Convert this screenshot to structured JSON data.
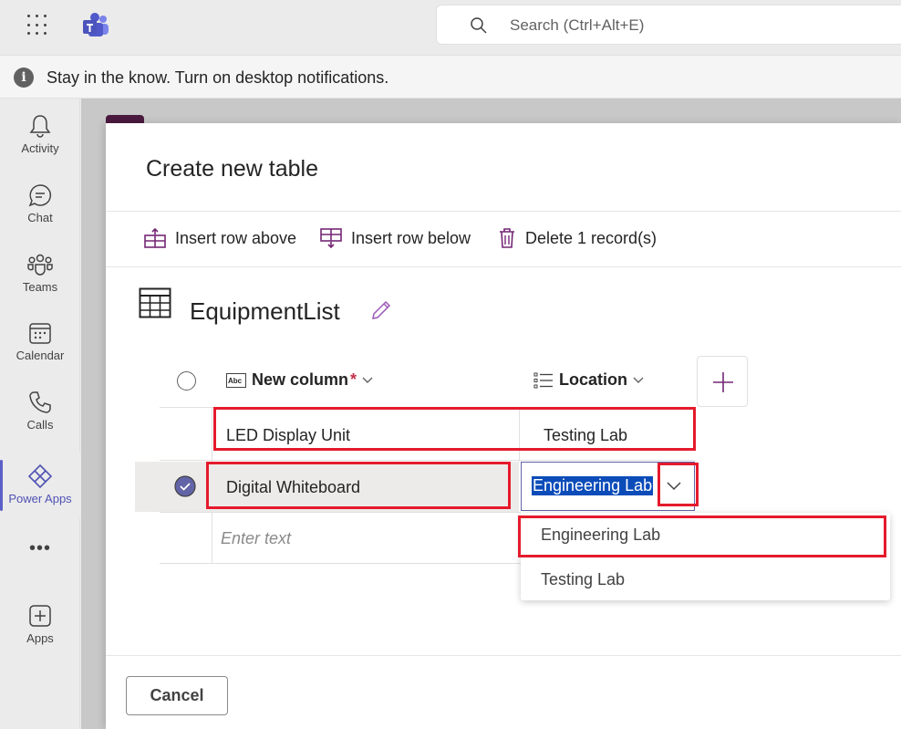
{
  "topbar": {
    "search_placeholder": "Search (Ctrl+Alt+E)"
  },
  "notification": {
    "text": "Stay in the know. Turn on desktop notifications."
  },
  "rail": {
    "items": [
      {
        "label": "Activity",
        "icon": "bell-icon"
      },
      {
        "label": "Chat",
        "icon": "chat-icon"
      },
      {
        "label": "Teams",
        "icon": "teams-icon"
      },
      {
        "label": "Calendar",
        "icon": "calendar-icon"
      },
      {
        "label": "Calls",
        "icon": "phone-icon"
      },
      {
        "label": "Power Apps",
        "icon": "power-apps-icon"
      },
      {
        "label": "Apps",
        "icon": "add-app-icon"
      }
    ],
    "more": "•••"
  },
  "modal": {
    "title": "Create new table",
    "toolbar": {
      "insert_above": "Insert row above",
      "insert_below": "Insert row below",
      "delete": "Delete 1 record(s)"
    },
    "table_name": "EquipmentList",
    "columns": [
      {
        "label": "New column",
        "required_mark": "*"
      },
      {
        "label": "Location"
      }
    ],
    "rows": [
      {
        "col1": "LED Display Unit",
        "col2": "Testing Lab"
      },
      {
        "col1": "Digital Whiteboard",
        "col2": "Engineering Lab"
      }
    ],
    "new_row_placeholder": "Enter text",
    "dropdown_options": [
      "Engineering Lab",
      "Testing Lab"
    ],
    "cancel": "Cancel"
  },
  "colors": {
    "accent": "#6264a7",
    "highlight_box": "#e51a2c",
    "selection": "#0b4cb9",
    "power_apps_purple": "#742774"
  }
}
